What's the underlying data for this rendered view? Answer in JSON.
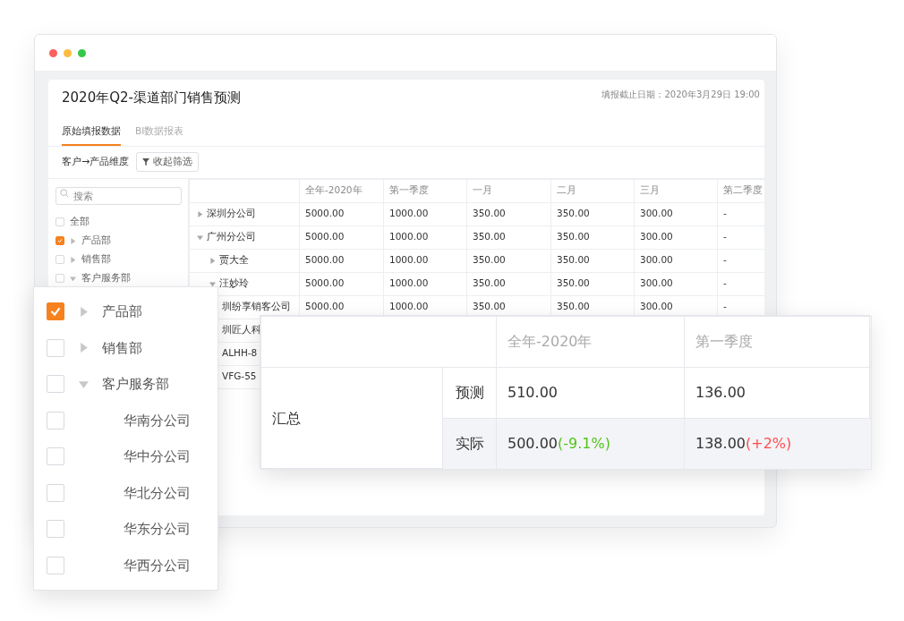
{
  "window": {
    "title": "2020年Q2-渠道部门销售预测",
    "deadline": "填报截止日期：2020年3月29日 19:00"
  },
  "tabs": [
    {
      "label": "原始填报数据",
      "selected": true
    },
    {
      "label": "BI数据报表",
      "selected": false
    }
  ],
  "toolbar": {
    "dimension": "客户→产品维度",
    "filter_button": "收起筛选"
  },
  "sidebar": {
    "search": {
      "placeholder": "搜索"
    },
    "items": [
      {
        "label": "全部",
        "checked": false
      },
      {
        "label": "产品部",
        "checked": true,
        "expanded": false
      },
      {
        "label": "销售部",
        "checked": false,
        "expanded": false
      },
      {
        "label": "客户服务部",
        "checked": false,
        "expanded": true
      }
    ]
  },
  "table": {
    "columns": [
      "全年-2020年",
      "第一季度",
      "一月",
      "二月",
      "三月",
      "第二季度"
    ],
    "rows": [
      {
        "label": "深圳分公司",
        "expanded": false,
        "values": [
          "5000.00",
          "1000.00",
          "350.00",
          "350.00",
          "300.00",
          "-"
        ]
      },
      {
        "label": "广州分公司",
        "expanded": true,
        "values": [
          "5000.00",
          "1000.00",
          "350.00",
          "350.00",
          "300.00",
          "-"
        ],
        "children": [
          {
            "label": "贾大全",
            "expanded": false,
            "values": [
              "5000.00",
              "1000.00",
              "350.00",
              "350.00",
              "300.00",
              "-"
            ]
          },
          {
            "label": "汪妙玲",
            "expanded": true,
            "values": [
              "5000.00",
              "1000.00",
              "350.00",
              "350.00",
              "300.00",
              "-"
            ],
            "children": [
              {
                "label": "圳纷享销客公司",
                "values": [
                  "5000.00",
                  "1000.00",
                  "350.00",
                  "350.00",
                  "300.00",
                  "-"
                ]
              },
              {
                "label": "圳匠人科"
              },
              {
                "label": "ALHH-8"
              },
              {
                "label": "VFG-55"
              }
            ]
          }
        ]
      }
    ]
  },
  "filter_panel": {
    "items": [
      {
        "label": "产品部",
        "checked": true,
        "expanded": false
      },
      {
        "label": "销售部",
        "checked": false,
        "expanded": false
      },
      {
        "label": "客户服务部",
        "checked": false,
        "expanded": true,
        "children": [
          {
            "label": "华南分公司",
            "checked": false
          },
          {
            "label": "华中分公司",
            "checked": false
          },
          {
            "label": "华北分公司",
            "checked": false
          },
          {
            "label": "华东分公司",
            "checked": false
          },
          {
            "label": "华西分公司",
            "checked": false
          }
        ]
      }
    ]
  },
  "summary": {
    "columns": [
      "全年-2020年",
      "第一季度"
    ],
    "group": "汇总",
    "rows": [
      {
        "label": "预测",
        "kind": "forecast",
        "cells": [
          {
            "value": "510.00"
          },
          {
            "value": "136.00"
          }
        ]
      },
      {
        "label": "实际",
        "kind": "actual",
        "cells": [
          {
            "value": "500.00",
            "change": "(-9.1%)",
            "color": "#52c41a"
          },
          {
            "value": "138.00",
            "change": "(+2%)",
            "color": "#ff4d4f"
          }
        ]
      }
    ]
  }
}
